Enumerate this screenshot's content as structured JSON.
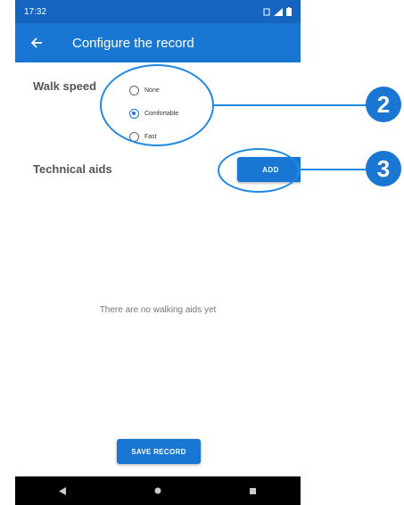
{
  "status_bar": {
    "time": "17:32"
  },
  "app_bar": {
    "title": "Configure the record",
    "back_icon": "arrow-left-icon"
  },
  "walk_speed": {
    "label": "Walk speed",
    "options": [
      {
        "label": "None",
        "checked": false
      },
      {
        "label": "Comfortable",
        "checked": true
      },
      {
        "label": "Fast",
        "checked": false
      }
    ]
  },
  "technical_aids": {
    "label": "Technical aids",
    "add_label": "ADD"
  },
  "empty_state": "There are no walking aids yet",
  "save_label": "SAVE RECORD",
  "callouts": {
    "walk_speed_badge": "2",
    "add_badge": "3"
  },
  "colors": {
    "primary": "#1976d2",
    "status_bar": "#1565c0",
    "callout": "#1e88e5"
  }
}
